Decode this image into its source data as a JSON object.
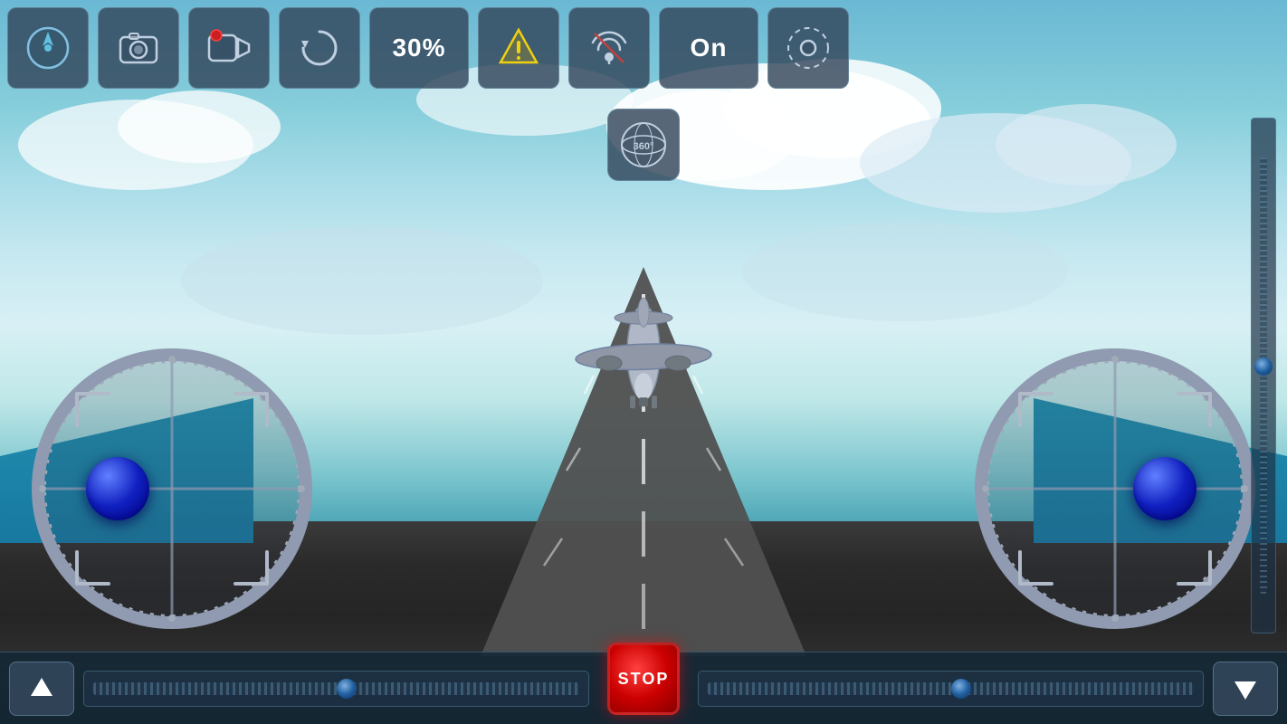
{
  "toolbar": {
    "buttons": [
      {
        "id": "nav-btn",
        "icon": "navigation",
        "label": "Navigation"
      },
      {
        "id": "camera-btn",
        "icon": "camera",
        "label": "Camera"
      },
      {
        "id": "video-btn",
        "icon": "video",
        "label": "Video Record"
      },
      {
        "id": "refresh-btn",
        "icon": "refresh",
        "label": "Refresh"
      },
      {
        "id": "zoom-btn",
        "icon": "zoom",
        "label": "30%",
        "text": "30%"
      },
      {
        "id": "warning-btn",
        "icon": "warning",
        "label": "Warning"
      },
      {
        "id": "signal-btn",
        "icon": "signal",
        "label": "Signal"
      },
      {
        "id": "onoff-btn",
        "icon": "on",
        "label": "On",
        "text": "On"
      },
      {
        "id": "settings-btn",
        "icon": "settings",
        "label": "Settings"
      }
    ]
  },
  "center_button": {
    "label": "360 View",
    "icon": "360"
  },
  "stop_button": {
    "label": "STOP"
  },
  "left_joystick": {
    "label": "Left Joystick"
  },
  "right_joystick": {
    "label": "Right Joystick"
  },
  "left_slider": {
    "label": "Left Horizontal Slider",
    "value": 50
  },
  "right_slider": {
    "label": "Right Horizontal Slider",
    "value": 50
  },
  "vertical_slider": {
    "label": "Altitude Slider",
    "value": 48
  },
  "bottom_up_arrow": {
    "label": "Up"
  },
  "bottom_down_arrow": {
    "label": "Down"
  },
  "colors": {
    "accent": "#4488cc",
    "bg_dark": "#1a3040",
    "toolbar_bg": "rgba(50,70,90,0.82)",
    "stop_red": "#cc0000"
  }
}
